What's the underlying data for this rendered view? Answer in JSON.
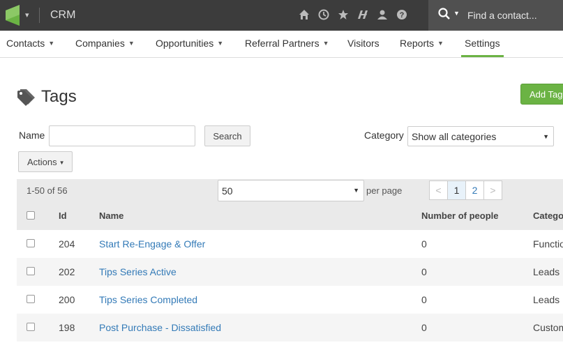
{
  "header": {
    "app_name": "CRM",
    "icons": [
      "home-icon",
      "clock-icon",
      "star-icon",
      "integrations-icon",
      "user-icon",
      "help-icon"
    ],
    "search_placeholder": "Find a contact..."
  },
  "nav": {
    "items": [
      {
        "label": "Contacts",
        "dropdown": true
      },
      {
        "label": "Companies",
        "dropdown": true
      },
      {
        "label": "Opportunities",
        "dropdown": true
      },
      {
        "label": "Referral Partners",
        "dropdown": true
      },
      {
        "label": "Visitors",
        "dropdown": false
      },
      {
        "label": "Reports",
        "dropdown": true
      },
      {
        "label": "Settings",
        "dropdown": false,
        "active": true
      }
    ]
  },
  "page": {
    "title": "Tags",
    "add_button": "Add Tag"
  },
  "filters": {
    "name_label": "Name",
    "name_value": "",
    "search_button": "Search",
    "category_label": "Category",
    "category_selected": "Show all categories",
    "actions_button": "Actions"
  },
  "pager": {
    "range": "1-50 of 56",
    "per_page_value": "50",
    "per_page_label": "per page",
    "prev": "<",
    "pages": [
      "1",
      "2"
    ],
    "current_page": "1",
    "next": ">"
  },
  "table": {
    "columns": {
      "id": "Id",
      "name": "Name",
      "number": "Number of people",
      "category": "Category"
    },
    "rows": [
      {
        "id": "204",
        "name": "Start Re-Engage & Offer",
        "number": "0",
        "category": "Functional"
      },
      {
        "id": "202",
        "name": "Tips Series Active",
        "number": "0",
        "category": "Leads"
      },
      {
        "id": "200",
        "name": "Tips Series Completed",
        "number": "0",
        "category": "Leads"
      },
      {
        "id": "198",
        "name": "Post Purchase - Dissatisfied",
        "number": "0",
        "category": "Customers"
      }
    ]
  },
  "colors": {
    "brand_green": "#6bb344",
    "topbar": "#3c3c3c",
    "link": "#337ab7"
  }
}
